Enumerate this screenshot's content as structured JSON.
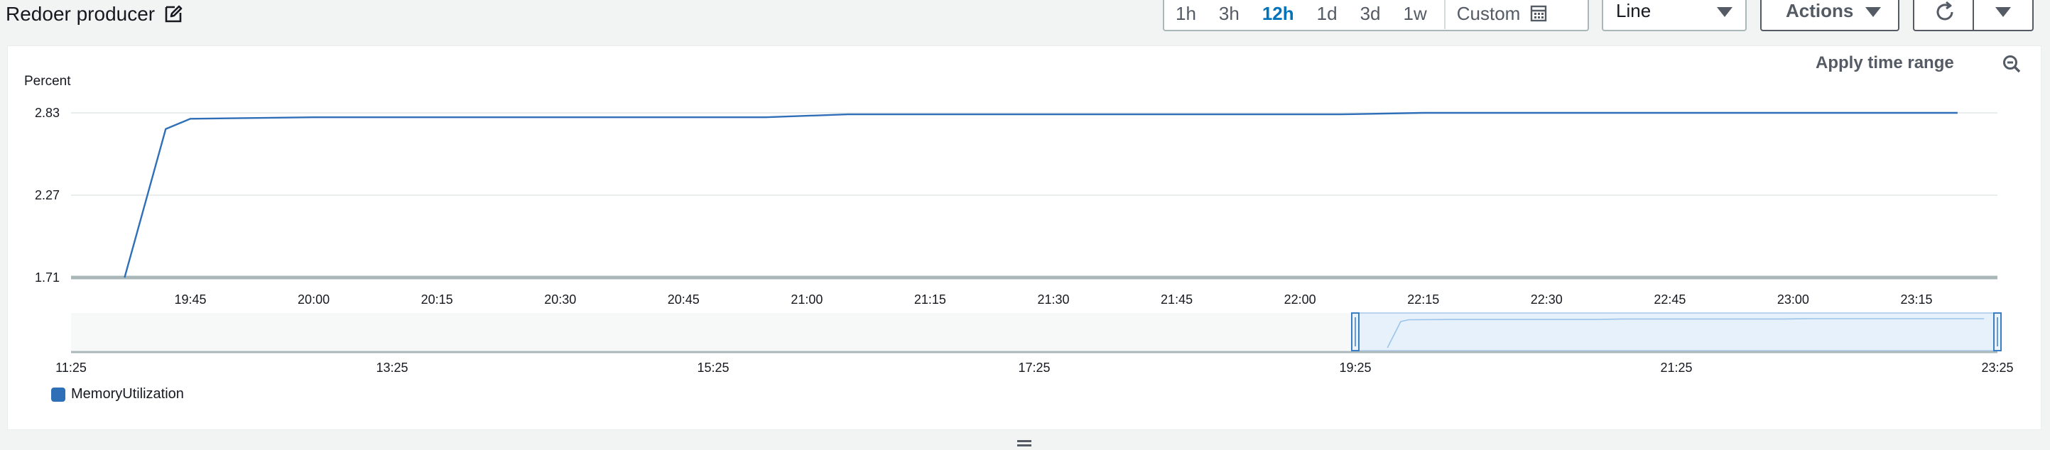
{
  "header": {
    "title": "Redoer producer",
    "time_ranges": [
      "1h",
      "3h",
      "12h",
      "1d",
      "3d",
      "1w"
    ],
    "active_range": "12h",
    "custom_label": "Custom",
    "chart_type_select": "Line",
    "actions_label": "Actions"
  },
  "panel": {
    "apply_time_range": "Apply time range",
    "unit_label": "Percent",
    "legend_label": "MemoryUtilization"
  },
  "colors": {
    "series": "#2e6fb7",
    "accent": "#0073bb",
    "navigator_fill": "#e7f1fb"
  },
  "chart_data": {
    "type": "line",
    "ylabel": "Percent",
    "yticks": [
      "1.71",
      "2.27",
      "2.83"
    ],
    "ylim": [
      1.71,
      2.85
    ],
    "x_ticks": [
      "19:45",
      "20:00",
      "20:15",
      "20:30",
      "20:45",
      "21:00",
      "21:15",
      "21:30",
      "21:45",
      "22:00",
      "22:15",
      "22:30",
      "22:45",
      "23:00",
      "23:15"
    ],
    "series": [
      {
        "name": "MemoryUtilization",
        "points": [
          [
            "19:37",
            1.71
          ],
          [
            "19:42",
            2.72
          ],
          [
            "19:45",
            2.79
          ],
          [
            "20:00",
            2.8
          ],
          [
            "20:30",
            2.8
          ],
          [
            "20:45",
            2.8
          ],
          [
            "20:55",
            2.8
          ],
          [
            "21:05",
            2.82
          ],
          [
            "21:15",
            2.82
          ],
          [
            "21:45",
            2.82
          ],
          [
            "22:05",
            2.82
          ],
          [
            "22:15",
            2.83
          ],
          [
            "22:45",
            2.83
          ],
          [
            "23:20",
            2.83
          ]
        ]
      }
    ],
    "navigator": {
      "ticks": [
        "11:25",
        "13:25",
        "15:25",
        "17:25",
        "19:25",
        "21:25",
        "23:25"
      ],
      "selection": [
        "19:25",
        "23:25"
      ]
    }
  }
}
